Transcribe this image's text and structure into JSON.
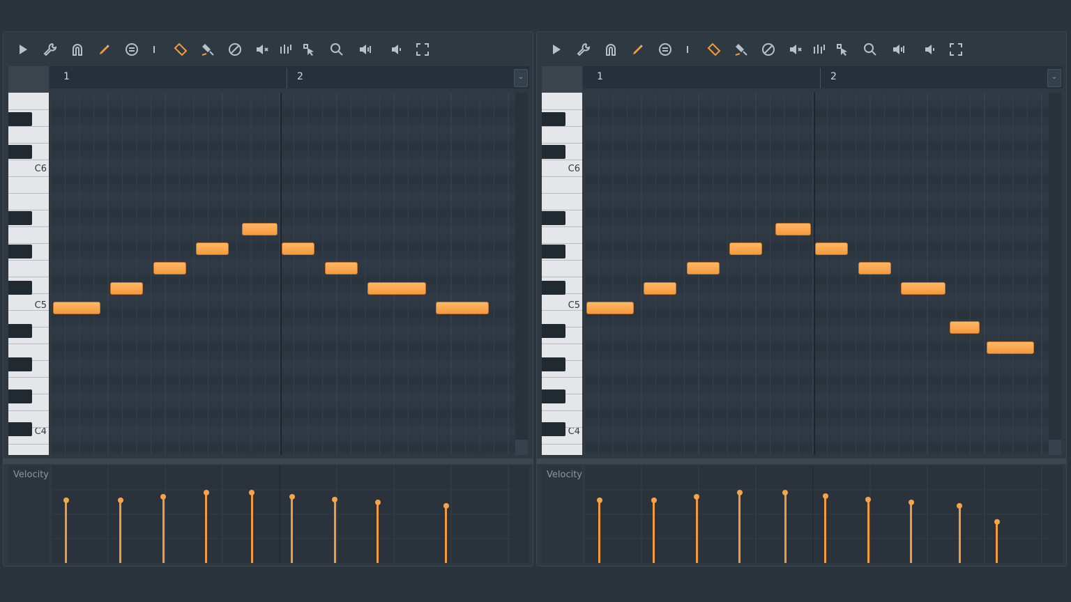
{
  "toolbar_icons": [
    "play-icon",
    "wrench-icon",
    "magnet-icon",
    "pencil-icon",
    "menu-circle-icon",
    "separator-icon",
    "tag-icon",
    "stamp-icon",
    "ban-icon",
    "mute-icon",
    "slice-icon",
    "select-icon",
    "zoom-icon",
    "volume-icon",
    "speaker-icon",
    "fullscreen-icon"
  ],
  "accent_color": "#f39a3c",
  "panels": [
    {
      "ruler": {
        "bar1": "1",
        "bar2": "2"
      },
      "keys": {
        "c6": "C6",
        "c5": "C5",
        "c4": "C4"
      },
      "velocity_label": "Velocity",
      "notes": [
        {
          "pitch": "C5",
          "start": 0.0,
          "length": 0.9
        },
        {
          "pitch": "D5",
          "start": 1.0,
          "length": 0.65
        },
        {
          "pitch": "E5",
          "start": 1.75,
          "length": 0.65
        },
        {
          "pitch": "F5",
          "start": 2.5,
          "length": 0.65
        },
        {
          "pitch": "G5",
          "start": 3.3,
          "length": 0.7
        },
        {
          "pitch": "F5",
          "start": 4.0,
          "length": 0.65
        },
        {
          "pitch": "E5",
          "start": 4.75,
          "length": 0.65
        },
        {
          "pitch": "D5",
          "start": 5.5,
          "length": 1.1
        },
        {
          "pitch": "C5",
          "start": 6.7,
          "length": 1.0
        }
      ],
      "velocities": [
        {
          "start": 0.05,
          "value": 0.7
        },
        {
          "start": 1.0,
          "value": 0.7
        },
        {
          "start": 1.75,
          "value": 0.74
        },
        {
          "start": 2.5,
          "value": 0.79
        },
        {
          "start": 3.3,
          "value": 0.79
        },
        {
          "start": 4.0,
          "value": 0.74
        },
        {
          "start": 4.75,
          "value": 0.71
        },
        {
          "start": 5.5,
          "value": 0.68
        },
        {
          "start": 6.7,
          "value": 0.64
        }
      ]
    },
    {
      "ruler": {
        "bar1": "1",
        "bar2": "2"
      },
      "keys": {
        "c6": "C6",
        "c5": "C5",
        "c4": "C4"
      },
      "velocity_label": "Velocity",
      "notes": [
        {
          "pitch": "C5",
          "start": 0.0,
          "length": 0.9
        },
        {
          "pitch": "D5",
          "start": 1.0,
          "length": 0.65
        },
        {
          "pitch": "E5",
          "start": 1.75,
          "length": 0.65
        },
        {
          "pitch": "F5",
          "start": 2.5,
          "length": 0.65
        },
        {
          "pitch": "G5",
          "start": 3.3,
          "length": 0.7
        },
        {
          "pitch": "F5",
          "start": 4.0,
          "length": 0.65
        },
        {
          "pitch": "E5",
          "start": 4.75,
          "length": 0.65
        },
        {
          "pitch": "D5",
          "start": 5.5,
          "length": 0.85
        },
        {
          "pitch": "B4",
          "start": 6.35,
          "length": 0.6
        },
        {
          "pitch": "A4",
          "start": 7.0,
          "length": 0.9
        }
      ],
      "velocities": [
        {
          "start": 0.05,
          "value": 0.7
        },
        {
          "start": 1.0,
          "value": 0.7
        },
        {
          "start": 1.75,
          "value": 0.74
        },
        {
          "start": 2.5,
          "value": 0.79
        },
        {
          "start": 3.3,
          "value": 0.79
        },
        {
          "start": 4.0,
          "value": 0.75
        },
        {
          "start": 4.75,
          "value": 0.71
        },
        {
          "start": 5.5,
          "value": 0.68
        },
        {
          "start": 6.35,
          "value": 0.64
        },
        {
          "start": 7.0,
          "value": 0.46
        }
      ]
    }
  ]
}
